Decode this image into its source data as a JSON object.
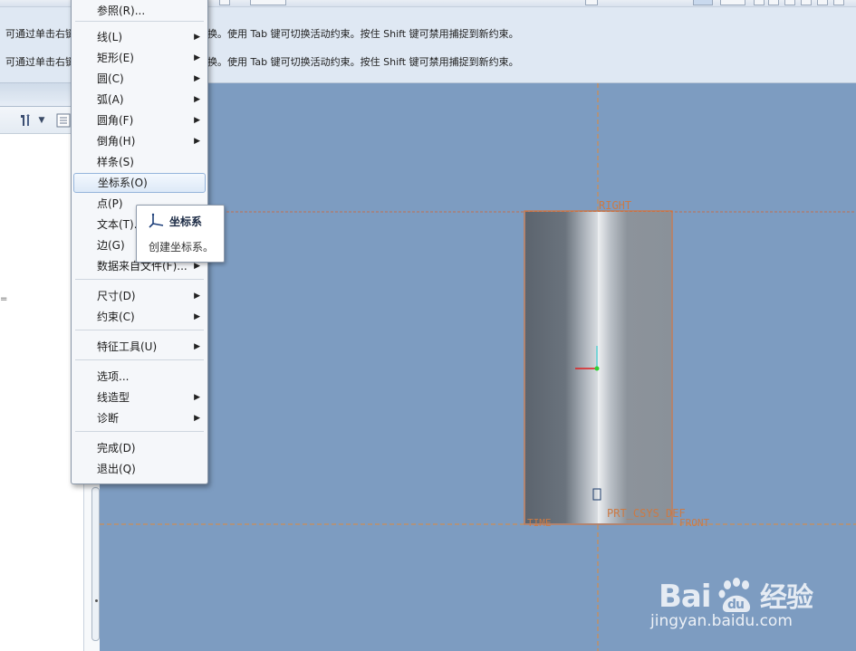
{
  "message_area": {
    "line1_left": "可通过单击右键",
    "line1_right": "换。使用 Tab 键可切换活动约束。按住 Shift 键可禁用捕捉到新约束。",
    "line2_left": "可通过单击右键",
    "line2_right": "换。使用 Tab 键可切换活动约束。按住 Shift 键可禁用捕捉到新约束。"
  },
  "context_menu": {
    "items": [
      {
        "label": "参照(R)...",
        "submenu": false
      },
      {
        "label": "线(L)",
        "submenu": true
      },
      {
        "label": "矩形(E)",
        "submenu": true
      },
      {
        "label": "圆(C)",
        "submenu": true
      },
      {
        "label": "弧(A)",
        "submenu": true
      },
      {
        "label": "圆角(F)",
        "submenu": true
      },
      {
        "label": "倒角(H)",
        "submenu": true
      },
      {
        "label": "样条(S)",
        "submenu": false
      },
      {
        "label": "坐标系(O)",
        "submenu": false,
        "highlighted": true
      },
      {
        "label": "点(P)",
        "submenu": false
      },
      {
        "label": "文本(T)...",
        "submenu": false
      },
      {
        "label": "边(G)",
        "submenu": false
      },
      {
        "label": "数据来自文件(F)...",
        "submenu": true
      },
      {
        "label": "尺寸(D)",
        "submenu": true
      },
      {
        "label": "约束(C)",
        "submenu": true
      },
      {
        "label": "特征工具(U)",
        "submenu": true
      },
      {
        "label": "选项...",
        "submenu": false
      },
      {
        "label": "线造型",
        "submenu": true
      },
      {
        "label": "诊断",
        "submenu": true
      },
      {
        "label": "完成(D)",
        "submenu": false
      },
      {
        "label": "退出(Q)",
        "submenu": false
      }
    ]
  },
  "tooltip": {
    "title": "坐标系",
    "description": "创建坐标系。",
    "icon": "coordinate-system-icon"
  },
  "graphics": {
    "datum_labels": {
      "right_plane": "RIGHT",
      "csys": "PRT_CSYS_DEF",
      "top_left": "TIME",
      "front": "FRONT"
    }
  },
  "left_panel": {
    "toolbar_icons": [
      "tools-icon",
      "dropdown-arrow-icon",
      "tree-icon"
    ],
    "side_mark": "="
  },
  "watermark": {
    "brand": "Bai du 经验",
    "url": "jingyan.baidu.com"
  },
  "colors": {
    "graphics_bg": "#7d9cc1",
    "datum_line": "#e07b3a",
    "menu_highlight": "#dde9f7"
  }
}
